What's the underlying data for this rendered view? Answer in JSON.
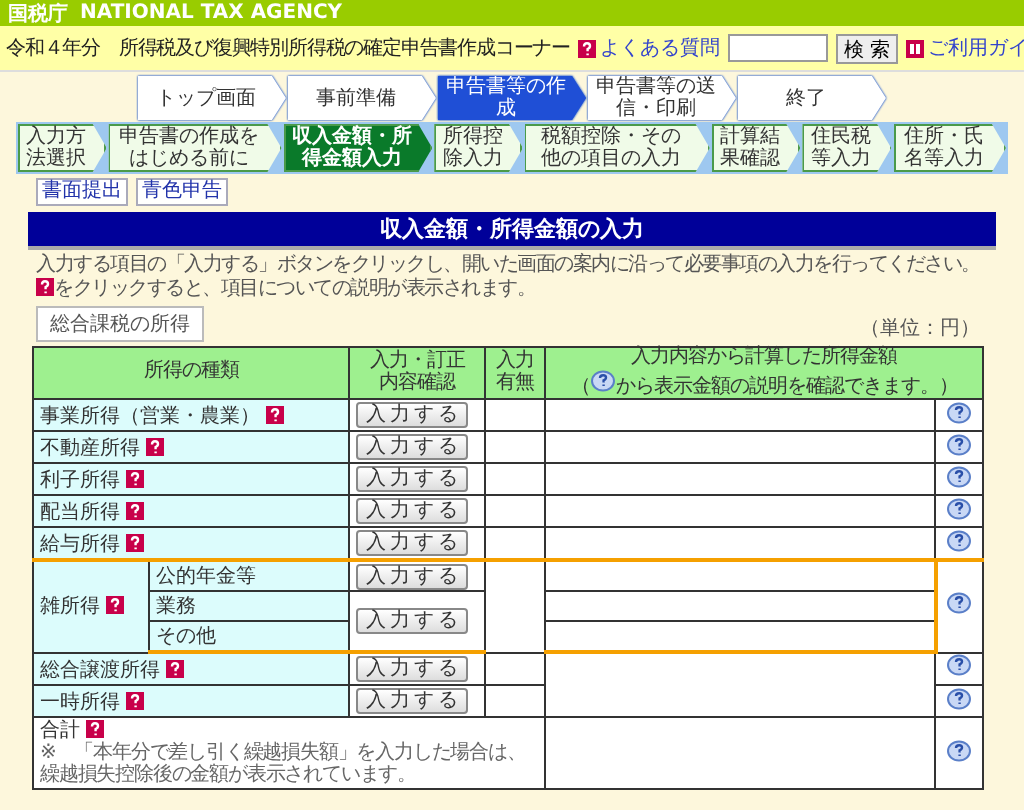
{
  "agency_bar": {
    "logo": "国税庁",
    "name": "NATIONAL TAX AGENCY"
  },
  "header": {
    "title": "令和４年分　所得税及び復興特別所得税の確定申告書作成コーナー",
    "faq": "よくある質問",
    "search_button": "検 索",
    "guide": "ご利用ガイ"
  },
  "main_steps": [
    {
      "label": "トップ画面",
      "selected": false
    },
    {
      "label": "事前準備",
      "selected": false
    },
    {
      "label": "申告書等の作成",
      "selected": true
    },
    {
      "label": "申告書等の送信・印刷",
      "selected": false
    },
    {
      "label": "終了",
      "selected": false
    }
  ],
  "sub_steps": [
    {
      "label": "入力方法選択",
      "selected": false
    },
    {
      "label": "申告書の作成をはじめる前に",
      "selected": false
    },
    {
      "label": "収入金額・所得金額入力",
      "selected": true
    },
    {
      "label": "所得控除入力",
      "selected": false
    },
    {
      "label": "税額控除・その他の項目の入力",
      "selected": false
    },
    {
      "label": "計算結果確認",
      "selected": false
    },
    {
      "label": "住民税等入力",
      "selected": false
    },
    {
      "label": "住所・氏名等入力",
      "selected": false
    }
  ],
  "form_buttons": [
    "書面提出",
    "青色申告"
  ],
  "page_title": "収入金額・所得金額の入力",
  "instructions": {
    "line1": "入力する項目の「入力する」ボタンをクリックし、開いた画面の案内に沿って必要事項の入力を行ってください。",
    "line2": "をクリックすると、項目についての説明が表示されます。"
  },
  "income_table": {
    "tab": "総合課税の所得",
    "unit": "（単位：円）",
    "columns": [
      {
        "lines": [
          "所得の種類"
        ]
      },
      {
        "lines": [
          "入力・訂正",
          "内容確認"
        ]
      },
      {
        "lines": [
          "入力",
          "有無"
        ]
      },
      {
        "lines": [
          "入力内容から計算した所得金額"
        ]
      }
    ],
    "amount_note_open": "（",
    "amount_note": "から表示金額の説明を確認できます。）",
    "rows": [
      {
        "label": "事業所得（営業・農業）",
        "button": "入力する"
      },
      {
        "label": "不動産所得",
        "button": "入力する"
      },
      {
        "label": "利子所得",
        "button": "入力する"
      },
      {
        "label": "配当所得",
        "button": "入力する"
      },
      {
        "label": "給与所得",
        "button": "入力する"
      }
    ],
    "misc": {
      "label": "雑所得",
      "parts": [
        "公的年金等",
        "業務",
        "その他"
      ],
      "buttons": [
        "入力する",
        "入力する"
      ]
    },
    "shared_rows": [
      {
        "label": "総合譲渡所得",
        "button": "入力する"
      },
      {
        "label": "一時所得",
        "button": "入力する"
      }
    ],
    "total": {
      "label": "合計",
      "note": "※　「本年分で差し引く繰越損失額」を入力した場合は、繰越損失控除後の金額が表示されています。"
    }
  }
}
